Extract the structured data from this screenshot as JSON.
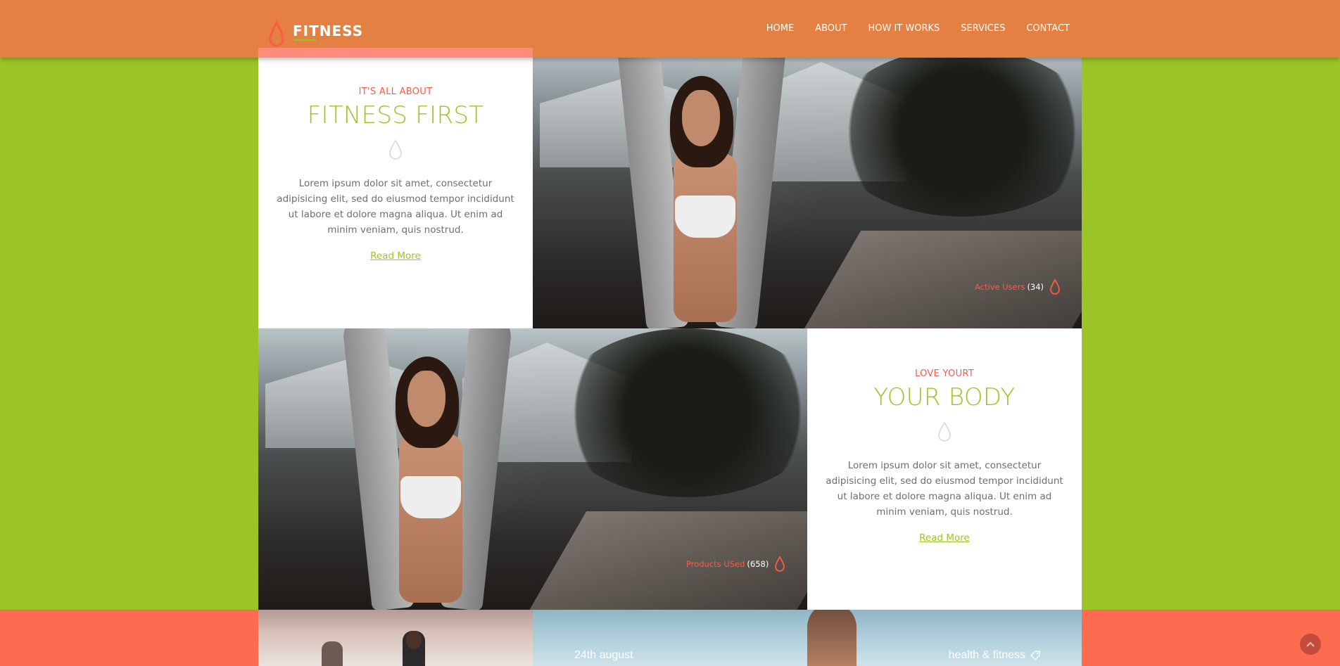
{
  "header": {
    "logo_text": "FITNESS",
    "nav": [
      "HOME",
      "ABOUT",
      "HOW IT WORKS",
      "SERVICES",
      "CONTACT"
    ]
  },
  "feature1": {
    "kicker": "IT'S ALL ABOUT",
    "heading": "FITNESS FIRST",
    "text": "Lorem ipsum dolor sit amet, consectetur adipisicing elit, sed do eiusmod tempor incididunt ut labore et dolore magna aliqua. Ut enim ad minim veniam, quis nostrud.",
    "link": "Read More",
    "badge_label": "Active Users",
    "badge_count": "(34)"
  },
  "feature2": {
    "kicker": "LOVE YOURT",
    "heading": "YOUR BODY",
    "text": "Lorem ipsum dolor sit amet, consectetur adipisicing elit, sed do eiusmod tempor incididunt ut labore et dolore magna aliqua. Ut enim ad minim veniam, quis nostrud.",
    "link": "Read More",
    "badge_label": "Products USed",
    "badge_count": "(658)"
  },
  "blog": {
    "date": "24th august",
    "category": "health & fitness"
  },
  "colors": {
    "header": "#e58043",
    "green": "#9bc526",
    "coral": "#fd6c50",
    "accent": "#fd5a46"
  },
  "icons": [
    "drop-icon",
    "tag-icon",
    "chevron-up-icon"
  ]
}
